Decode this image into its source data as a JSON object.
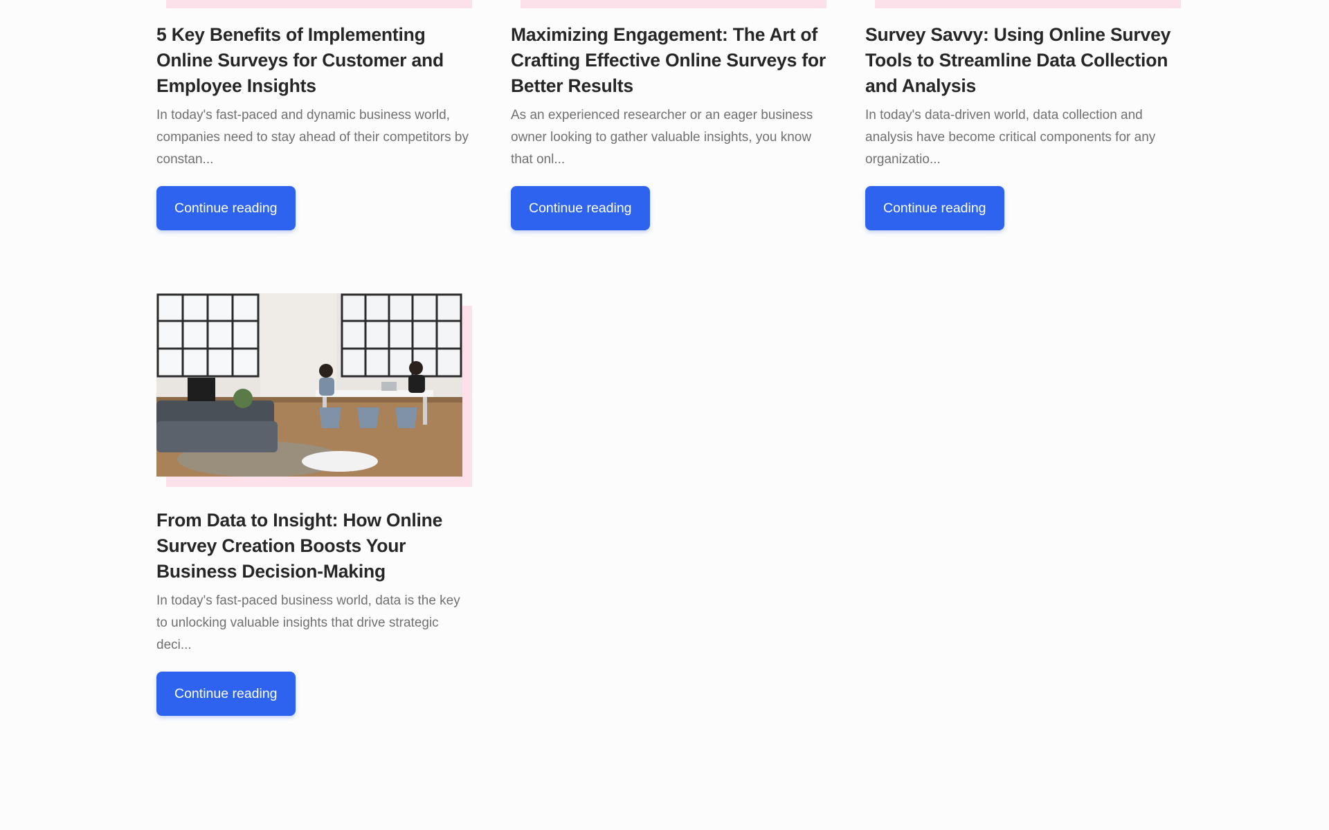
{
  "posts": [
    {
      "title": "5 Key Benefits of Implementing Online Surveys for Customer and Employee Insights",
      "excerpt": "In today's fast-paced and dynamic business world, companies need to stay ahead of their competitors by constan...",
      "button_label": "Continue reading"
    },
    {
      "title": "Maximizing Engagement: The Art of Crafting Effective Online Surveys for Better Results",
      "excerpt": "As an experienced researcher or an eager business owner looking to gather valuable insights, you know that onl...",
      "button_label": "Continue reading"
    },
    {
      "title": "Survey Savvy: Using Online Survey Tools to Streamline Data Collection and Analysis",
      "excerpt": "In today's data-driven world, data collection and analysis have become critical components for any organizatio...",
      "button_label": "Continue reading"
    },
    {
      "title": "From Data to Insight: How Online Survey Creation Boosts Your Business Decision-Making",
      "excerpt": "In today's fast-paced business world, data is the key to unlocking valuable insights that drive strategic deci...",
      "button_label": "Continue reading",
      "image_icon": "office-photo"
    }
  ],
  "colors": {
    "background": "#fcfcfc",
    "accent_button": "#2d63ef",
    "pink_decoration": "#fde1ea",
    "title_text": "#262626",
    "excerpt_text": "#707070"
  }
}
